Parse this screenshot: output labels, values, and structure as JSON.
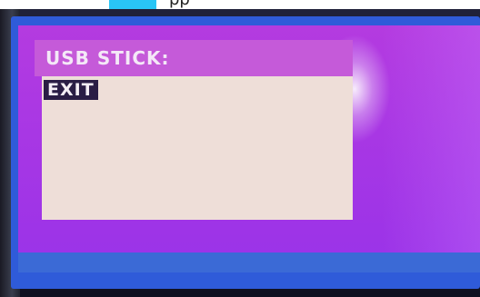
{
  "top_strip": {
    "text": "pp"
  },
  "screen": {
    "title": "USB STICK:",
    "items": [
      {
        "label": "EXIT",
        "selected": true
      }
    ]
  },
  "colors": {
    "lcd_purple": "#a837e4",
    "lcd_edge_blue": "#2f5bd9",
    "menu_body": "#eeded8",
    "selection_bg": "#2a1d45",
    "caption_highlight": "#29c5f6"
  }
}
